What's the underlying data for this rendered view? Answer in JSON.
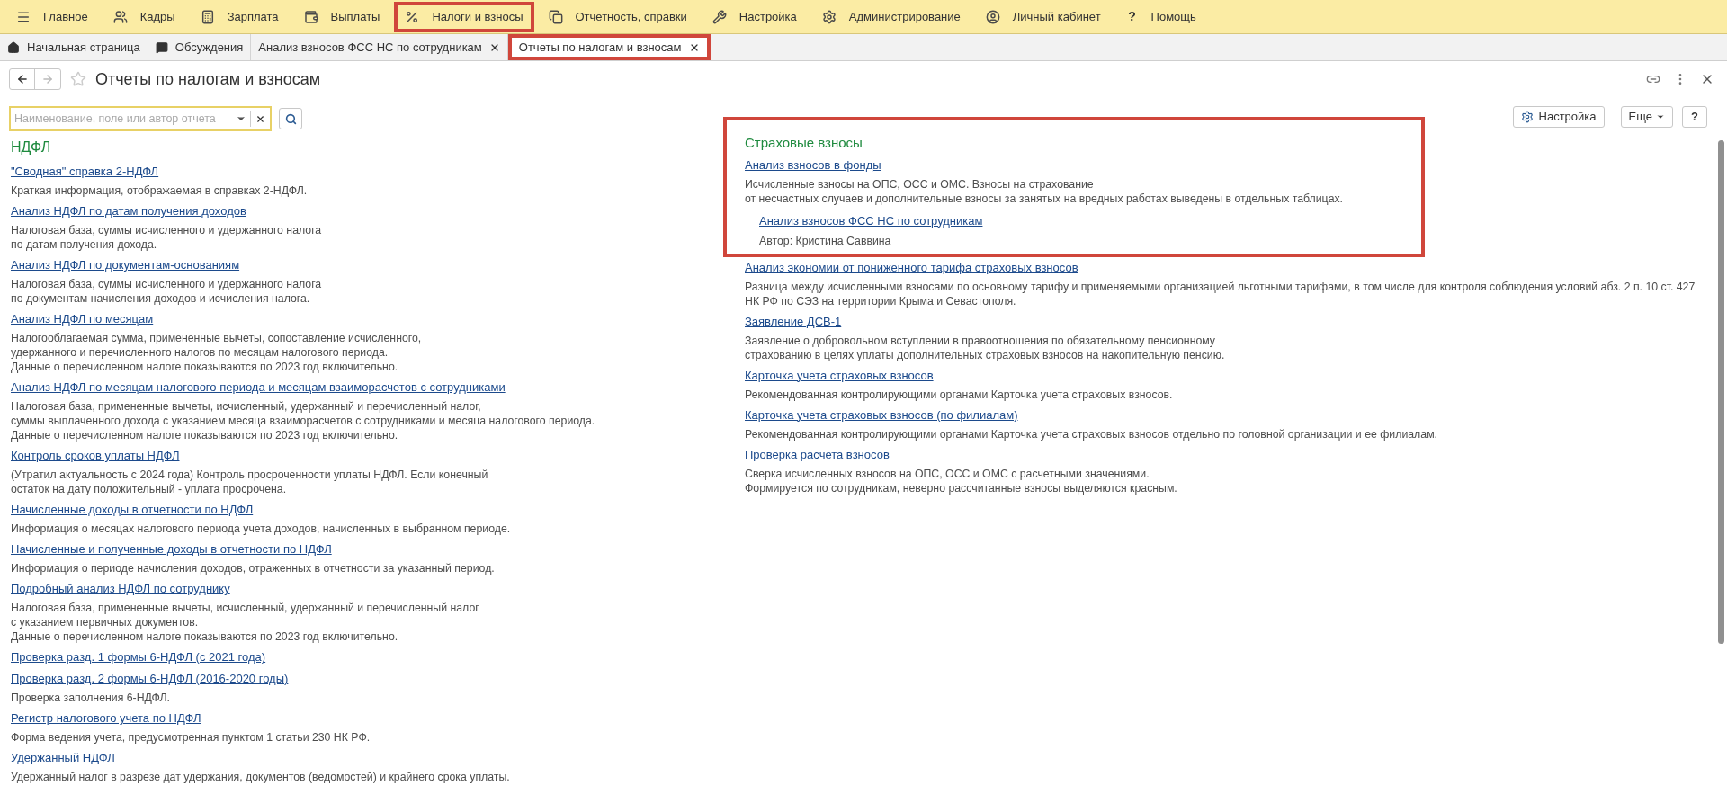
{
  "menu": [
    {
      "label": "Главное",
      "highlighted": false
    },
    {
      "label": "Кадры",
      "highlighted": false
    },
    {
      "label": "Зарплата",
      "highlighted": false
    },
    {
      "label": "Выплаты",
      "highlighted": false
    },
    {
      "label": "Налоги и взносы",
      "highlighted": true
    },
    {
      "label": "Отчетность, справки",
      "highlighted": false
    },
    {
      "label": "Настройка",
      "highlighted": false
    },
    {
      "label": "Администрирование",
      "highlighted": false
    },
    {
      "label": "Личный кабинет",
      "highlighted": false
    },
    {
      "glyph": "?",
      "label": "Помощь",
      "highlighted": false
    }
  ],
  "tabs": [
    {
      "label": "Начальная страница",
      "selected": false,
      "closable": false,
      "highlighted": false
    },
    {
      "label": "Обсуждения",
      "selected": false,
      "closable": false,
      "highlighted": false
    },
    {
      "label": "Анализ взносов ФСС НС по сотрудникам",
      "selected": false,
      "closable": true,
      "highlighted": false
    },
    {
      "label": "Отчеты по налогам и взносам",
      "selected": true,
      "closable": true,
      "highlighted": true
    }
  ],
  "page_title": "Отчеты по налогам и взносам",
  "search": {
    "placeholder": "Наименование, поле или автор отчета"
  },
  "buttons": {
    "settings": "Настройка",
    "more": "Еще",
    "help": "?"
  },
  "ndfl": {
    "heading": "НДФЛ",
    "items": [
      {
        "title": "\"Сводная\" справка 2-НДФЛ",
        "description": [
          "Краткая информация, отображаемая в справках 2-НДФЛ."
        ]
      },
      {
        "title": "Анализ НДФЛ по датам получения доходов",
        "description": [
          "Налоговая база, суммы исчисленного и удержанного налога",
          "по датам получения дохода."
        ]
      },
      {
        "title": "Анализ НДФЛ по документам-основаниям",
        "description": [
          "Налоговая база, суммы исчисленного и удержанного налога",
          "по документам начисления доходов и исчисления налога."
        ]
      },
      {
        "title": "Анализ НДФЛ по месяцам",
        "description": [
          "Налогооблагаемая сумма, примененные вычеты, сопоставление исчисленного,",
          "удержанного и перечисленного налогов по месяцам налогового периода.",
          "Данные о перечисленном налоге показываются по 2023 год включительно."
        ]
      },
      {
        "title": "Анализ НДФЛ по месяцам налогового периода и месяцам взаиморасчетов с сотрудниками",
        "description": [
          "Налоговая база, примененные вычеты, исчисленный, удержанный и перечисленный налог,",
          "суммы выплаченного дохода с указанием месяца взаиморасчетов с сотрудниками и месяца налогового периода.",
          "Данные о перечисленном налоге показываются по 2023 год включительно."
        ]
      },
      {
        "title": "Контроль сроков уплаты НДФЛ",
        "description": [
          "(Утратил актуальность с 2024 года) Контроль просроченности уплаты НДФЛ. Если конечный",
          "остаток на дату положительный - уплата просрочена."
        ]
      },
      {
        "title": "Начисленные доходы в отчетности по НДФЛ",
        "description": [
          "Информация о месяцах налогового периода учета доходов, начисленных в выбранном периоде."
        ]
      },
      {
        "title": "Начисленные и полученные доходы в отчетности по НДФЛ",
        "description": [
          "Информация о периоде начисления доходов, отраженных в отчетности за указанный период."
        ]
      },
      {
        "title": "Подробный анализ НДФЛ по сотруднику",
        "description": [
          "Налоговая база, примененные вычеты, исчисленный, удержанный и перечисленный налог",
          "с указанием первичных документов.",
          "Данные о перечисленном налоге показываются по 2023 год включительно."
        ]
      },
      {
        "title": "Проверка разд. 1 формы 6-НДФЛ (с 2021 года)"
      },
      {
        "title": "Проверка разд. 2 формы 6-НДФЛ (2016-2020 годы)",
        "description": [
          "Проверка заполнения 6-НДФЛ."
        ]
      },
      {
        "title": "Регистр налогового учета по НДФЛ",
        "description": [
          "Форма ведения учета, предусмотренная пунктом 1 статьи 230 НК РФ."
        ]
      },
      {
        "title": "Удержанный НДФЛ",
        "description": [
          "Удержанный налог в разрезе дат удержания, документов (ведомостей) и крайнего срока уплаты."
        ]
      }
    ]
  },
  "insurance": {
    "heading": "Страховые взносы",
    "items": [
      {
        "title": "Анализ взносов в фонды",
        "description": [
          "Исчисленные взносы на ОПС, ОСС и ОМС. Взносы на страхование",
          "от несчастных случаев и дополнительные взносы за занятых на вредных работах выведены в отдельных таблицах."
        ],
        "children": [
          {
            "title": "Анализ взносов ФСС НС по сотрудникам",
            "author": "Автор: Кристина Саввина"
          }
        ]
      },
      {
        "title": "Анализ экономии от пониженного тарифа страховых взносов",
        "description": [
          "Разница между исчисленными взносами по основному тарифу и применяемыми организацией льготными тарифами, в том числе для контроля соблюдения условий абз. 2 п. 10 ст. 427",
          "НК РФ по СЭЗ на территории Крыма и Севастополя."
        ]
      },
      {
        "title": "Заявление ДСВ-1",
        "description": [
          "Заявление о добровольном вступлении в правоотношения по обязательному пенсионному",
          "страхованию в целях уплаты дополнительных страховых взносов на накопительную пенсию."
        ]
      },
      {
        "title": "Карточка учета страховых взносов",
        "description": [
          "Рекомендованная контролирующими органами Карточка учета страховых взносов."
        ]
      },
      {
        "title": "Карточка учета страховых взносов (по филиалам)",
        "description": [
          "Рекомендованная контролирующими органами Карточка учета страховых взносов отдельно по головной организации и ее филиалам."
        ]
      },
      {
        "title": "Проверка расчета взносов",
        "description": [
          "Сверка исчисленных взносов на ОПС, ОСС и ОМС с расчетными значениями.",
          "Формируется по сотрудникам, неверно рассчитанные взносы выделяются красным."
        ]
      }
    ]
  }
}
